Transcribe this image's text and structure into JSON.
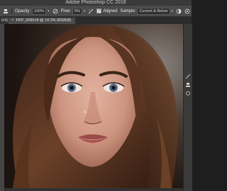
{
  "app": {
    "title": "Adobe Photoshop CC 2018"
  },
  "options_bar": {
    "opacity_label": "Opacity:",
    "opacity_value": "100%",
    "flow_label": "Flow:",
    "flow_value": "5%",
    "aligned_label": "Aligned",
    "aligned_checked": true,
    "sample_label": "Sample:",
    "sample_value": "Current & Below"
  },
  "document_tab": {
    "prev_label": "6/8) ×",
    "title": "FKP_0090.tif @ 14.2% (RGB/8)"
  },
  "colors": {
    "accent": "#4a4a4a",
    "canvas_bg": "#2a2220"
  }
}
